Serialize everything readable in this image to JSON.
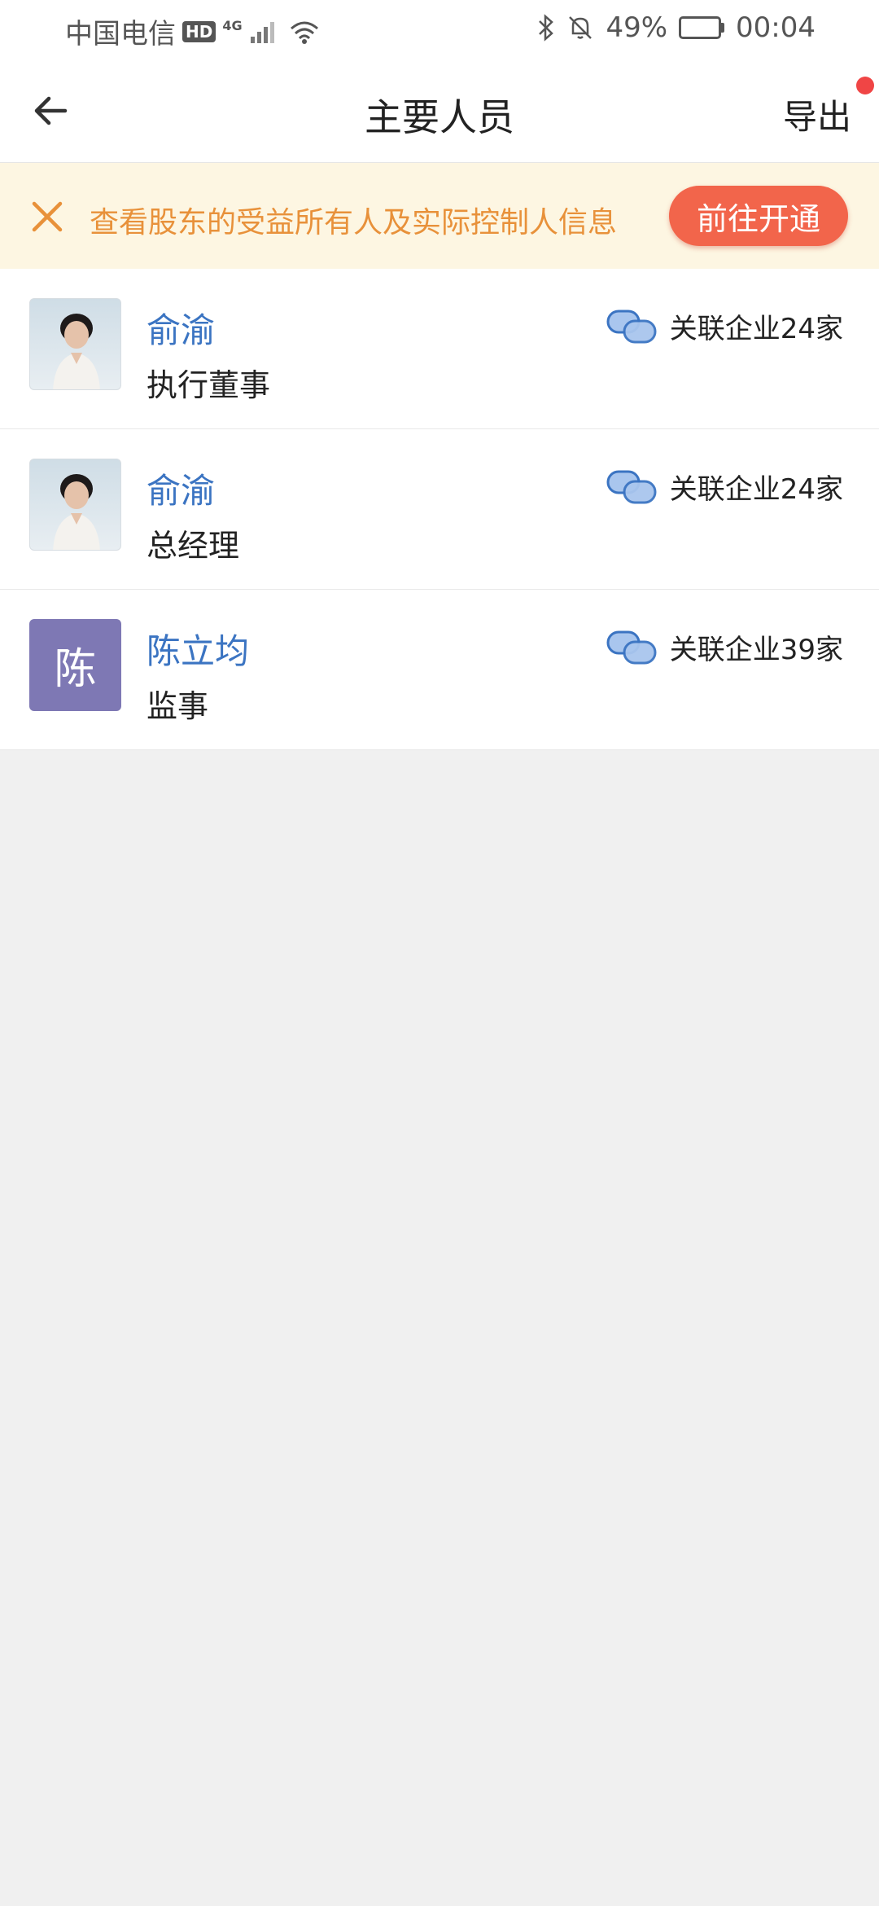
{
  "status_bar": {
    "carrier": "中国电信",
    "hd_label": "HD",
    "network": "4G",
    "battery_percent": "49%",
    "battery_level": 0.49,
    "time": "00:04"
  },
  "navbar": {
    "title": "主要人员",
    "export_label": "导出",
    "has_notification_dot": true
  },
  "banner": {
    "text": "查看股东的受益所有人及实际控制人信息",
    "button_label": "前往开通",
    "text_color": "#e8913a",
    "button_color": "#f2654b"
  },
  "people": [
    {
      "name": "俞渝",
      "role": "执行董事",
      "related": "关联企业24家",
      "avatar": "photo"
    },
    {
      "name": "俞渝",
      "role": "总经理",
      "related": "关联企业24家",
      "avatar": "photo"
    },
    {
      "name": "陈立均",
      "role": "监事",
      "related": "关联企业39家",
      "avatar": "letter",
      "avatar_letter": "陈",
      "avatar_color": "#7e78b4"
    }
  ],
  "icons": {
    "back": "arrow-left-icon",
    "close": "close-icon",
    "related": "linked-bubbles-icon"
  },
  "colors": {
    "name_link": "#3b74c2",
    "notification_dot": "#f04545",
    "page_background": "#f0f0f0"
  }
}
